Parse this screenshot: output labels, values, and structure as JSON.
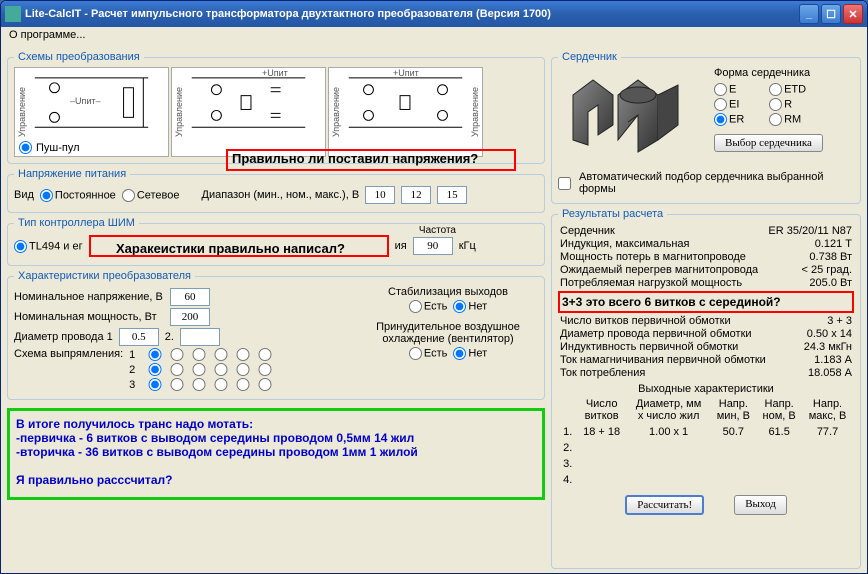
{
  "window": {
    "title": "Lite-CalcIT - Расчет импульсного трансформатора двухтактного преобразователя (Версия 1700)"
  },
  "menu": {
    "about": "О программе..."
  },
  "schemes": {
    "legend": "Схемы преобразования",
    "upit_plus": "+Uпит",
    "upit_minus": "–Uпит–",
    "control": "Управление",
    "push_pull": "Пуш-пул"
  },
  "power": {
    "legend": "Напряжение питания",
    "type_label": "Вид",
    "dc": "Постоянное",
    "ac": "Сетевое",
    "range_label": "Диапазон (мин., ном., макс.), В",
    "min": "10",
    "nom": "12",
    "max": "15"
  },
  "pwm": {
    "legend": "Тип контроллера ШИМ",
    "tl494": "TL494 и ег",
    "freq_suffix": "ия",
    "freq": "90",
    "freq_unit": "кГц"
  },
  "conv": {
    "legend": "Характеристики преобразователя",
    "nom_v": "Номинальное напряжение, В",
    "nom_v_val": "60",
    "nom_p": "Номинальная мощность, Вт",
    "nom_p_val": "200",
    "wire_d": "Диаметр провода 1",
    "wire_d_val": "0.5",
    "wire_d2": "2.",
    "rect": "Схема выпрямления:",
    "stab": "Стабилизация выходов",
    "yes": "Есть",
    "no": "Нет",
    "forced": "Принудительное воздушное охлаждение (вентилятор)"
  },
  "annotations": {
    "q1": "Правильно ли поставил напряжения?",
    "q2": "Харакеистики правильно написал?",
    "q4": "Частота",
    "summary": "В итоге получилось транс надо мотать:\n-первичка - 6 витков  с выводом середины проводом 0,5мм 14 жил\n-вторичка -  36 витков с выводом середины проводом 1мм 1 жилой\n\nЯ правильно расссчитал?"
  },
  "core": {
    "legend": "Сердечник",
    "shape_label": "Форма сердечника",
    "e": "E",
    "etd": "ETD",
    "ei": "EI",
    "r": "R",
    "er": "ER",
    "rm": "RM",
    "select_btn": "Выбор сердечника",
    "auto": "Автоматический подбор сердечника выбранной формы"
  },
  "results": {
    "legend": "Результаты расчета",
    "core_label": "Сердечник",
    "core_val": "ER 35/20/11 N87",
    "induct_label": "Индукция, максимальная",
    "induct_val": "0.121 Т",
    "loss_label": "Мощность потерь в магнитопроводе",
    "loss_val": "0.738 Вт",
    "dt_label": "Ожидаемый перегрев магнитопровода",
    "dt_val": "< 25 град.",
    "load_label": "Потребляемая нагрузкой мощность",
    "load_val": "205.0 Вт",
    "q3": "3+3 это  всего 6 витков с серединой?",
    "prim_turns_label": "Число витков первичной обмотки",
    "prim_turns_val": "3 + 3",
    "prim_wire_label": "Диаметр провода первичной обмотки",
    "prim_wire_val": "0.50 x 14",
    "prim_L_label": "Индуктивность первичной обмотки",
    "prim_L_val": "24.3 мкГн",
    "prim_I_label": "Ток намагничивания первичной обмотки",
    "prim_I_val": "1.183 А",
    "consump_label": "Ток потребления",
    "consump_val": "18.058 А",
    "out_title": "Выходные характеристики",
    "col1a": "Число",
    "col1b": "витков",
    "col2a": "Диаметр, мм",
    "col2b": "x число жил",
    "col3a": "Напр.",
    "col3b": "мин, В",
    "col4a": "Напр.",
    "col4b": "ном, В",
    "col5a": "Напр.",
    "col5b": "макс, В",
    "row1": {
      "turns": "18 + 18",
      "wire": "1.00 x 1",
      "vmin": "50.7",
      "vnom": "61.5",
      "vmax": "77.7"
    }
  },
  "buttons": {
    "calc": "Рассчитать!",
    "exit": "Выход"
  }
}
